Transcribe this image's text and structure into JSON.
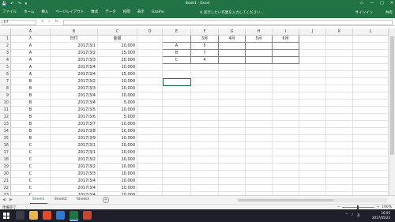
{
  "window": {
    "title": "Book1 - Excel"
  },
  "qat": {
    "save": "💾",
    "undo": "↶",
    "redo": "↷",
    "more": "▾"
  },
  "window_buttons": {
    "restore": "▭",
    "min": "—",
    "max": "□",
    "close": "✕"
  },
  "ribbon": {
    "tabs": [
      "ファイル",
      "ホーム",
      "挿入",
      "ページレイアウト",
      "数式",
      "データ",
      "校閲",
      "表示",
      "Gaaiho"
    ],
    "tell_me": "♀ 実行したい作業を入力してください...",
    "user": "サインイン",
    "share": "共有"
  },
  "formula_bar": {
    "name_box": "E7",
    "cancel": "✕",
    "enter": "✓",
    "fx": "fx",
    "value": ""
  },
  "grid": {
    "columns": [
      "A",
      "B",
      "C",
      "D",
      "E",
      "F",
      "G",
      "H",
      "I",
      "J",
      "K",
      "L"
    ],
    "row_numbers": [
      "1",
      "2",
      "3",
      "4",
      "5",
      "6",
      "7",
      "8",
      "9",
      "10",
      "11",
      "12",
      "13",
      "14",
      "15",
      "16",
      "17",
      "18",
      "19",
      "20",
      "21",
      "22",
      "23",
      "24"
    ],
    "headers": {
      "a": "人",
      "b": "日付",
      "c": "金額"
    },
    "rows": [
      [
        "A",
        "2017/3/1",
        "10,000"
      ],
      [
        "A",
        "2017/3/2",
        "15,000"
      ],
      [
        "A",
        "2017/3/3",
        "20,000"
      ],
      [
        "A",
        "2017/3/4",
        "10,000"
      ],
      [
        "A",
        "2017/3/4",
        "15,000"
      ],
      [
        "B",
        "2017/3/2",
        "10,000"
      ],
      [
        "B",
        "2017/3/3",
        "10,000"
      ],
      [
        "B",
        "2017/3/4",
        "10,000"
      ],
      [
        "B",
        "2017/3/4",
        "5,000"
      ],
      [
        "B",
        "2017/3/5",
        "10,000"
      ],
      [
        "B",
        "2017/3/6",
        "5,000"
      ],
      [
        "B",
        "2017/3/7",
        "10,000"
      ],
      [
        "B",
        "2017/3/8",
        "10,000"
      ],
      [
        "B",
        "2017/3/9",
        "10,000"
      ],
      [
        "C",
        "2017/3/1",
        "10,000"
      ],
      [
        "C",
        "2017/3/1",
        "10,000"
      ],
      [
        "C",
        "2017/3/2",
        "10,000"
      ],
      [
        "C",
        "2017/3/2",
        "10,000"
      ],
      [
        "C",
        "2017/3/3",
        "10,000"
      ],
      [
        "C",
        "2017/3/4",
        "10,000"
      ],
      [
        "C",
        "2017/3/4",
        "10,000"
      ],
      [
        "C",
        "2017/3/4",
        "10,000"
      ]
    ],
    "summary": {
      "month_headers": [
        "3月",
        "4月",
        "5月",
        "6月"
      ],
      "rows": [
        {
          "person": "A",
          "values": [
            "5",
            "",
            "",
            ""
          ]
        },
        {
          "person": "B",
          "values": [
            "7",
            "",
            "",
            ""
          ]
        },
        {
          "person": "C",
          "values": [
            "4",
            "",
            "",
            ""
          ]
        }
      ]
    }
  },
  "sheets": {
    "tabs": [
      "Sheet1",
      "Sheet2",
      "Sheet3"
    ],
    "active": "Sheet1",
    "add": "+",
    "nav_prev": "◀",
    "nav_next": "▶"
  },
  "status": {
    "text": "準備完了",
    "zoom": "100%",
    "zoom_out": "−",
    "zoom_in": "+"
  },
  "taskbar": {
    "time": "16:05",
    "date": "2017/05/22",
    "tray": [
      "^",
      "♪",
      "あ"
    ]
  },
  "colors": {
    "excel_green": "#217346",
    "taskbar": "#1f1f2b"
  }
}
